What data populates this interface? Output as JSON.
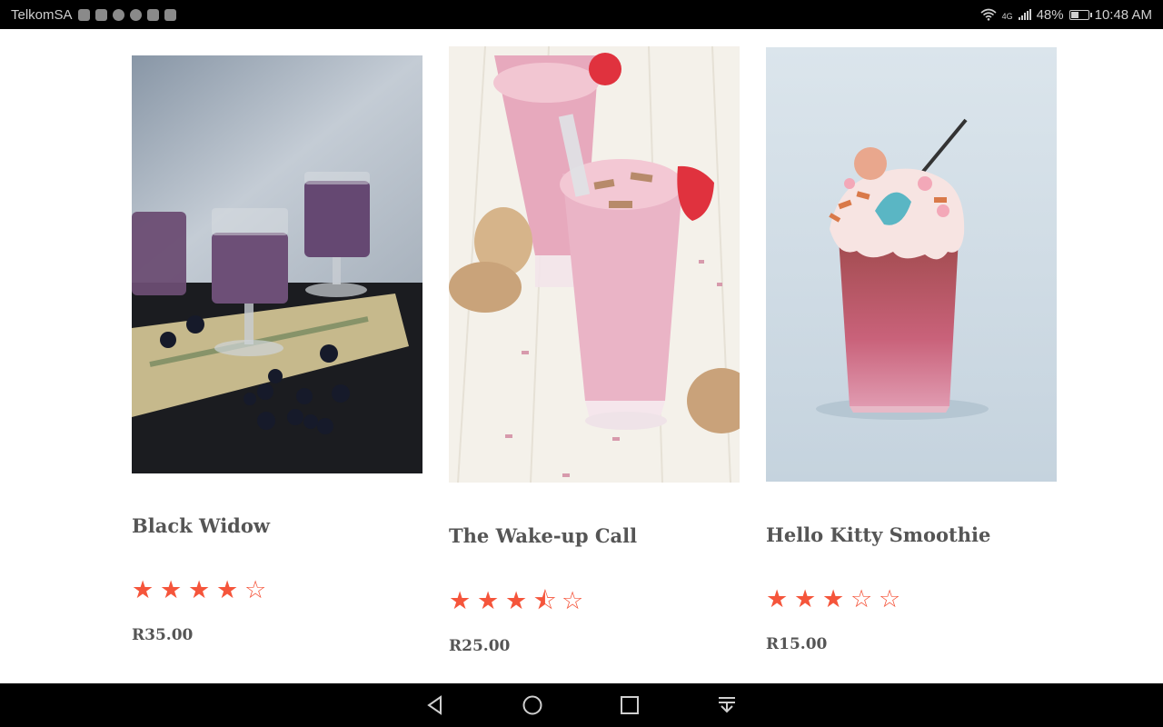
{
  "status_bar": {
    "carrier": "TelkomSA",
    "network": "4G",
    "battery": "48%",
    "battery_level": 0.48,
    "time": "10:48 AM"
  },
  "products": [
    {
      "name": "Black Widow",
      "price": "R35.00",
      "rating": 4,
      "stars": [
        "★",
        "★",
        "★",
        "★",
        "☆"
      ]
    },
    {
      "name": "The Wake-up Call",
      "price": "R25.00",
      "rating": 3.5,
      "stars": [
        "★",
        "★",
        "★",
        "⯪",
        "☆"
      ]
    },
    {
      "name": "Hello Kitty Smoothie",
      "price": "R15.00",
      "rating": 3,
      "stars": [
        "★",
        "★",
        "★",
        "☆",
        "☆"
      ]
    }
  ],
  "colors": {
    "star": "#f5553b",
    "text": "#555555"
  },
  "nav_icons": [
    "back-icon",
    "home-icon",
    "recents-icon",
    "notification-drawer-icon"
  ]
}
